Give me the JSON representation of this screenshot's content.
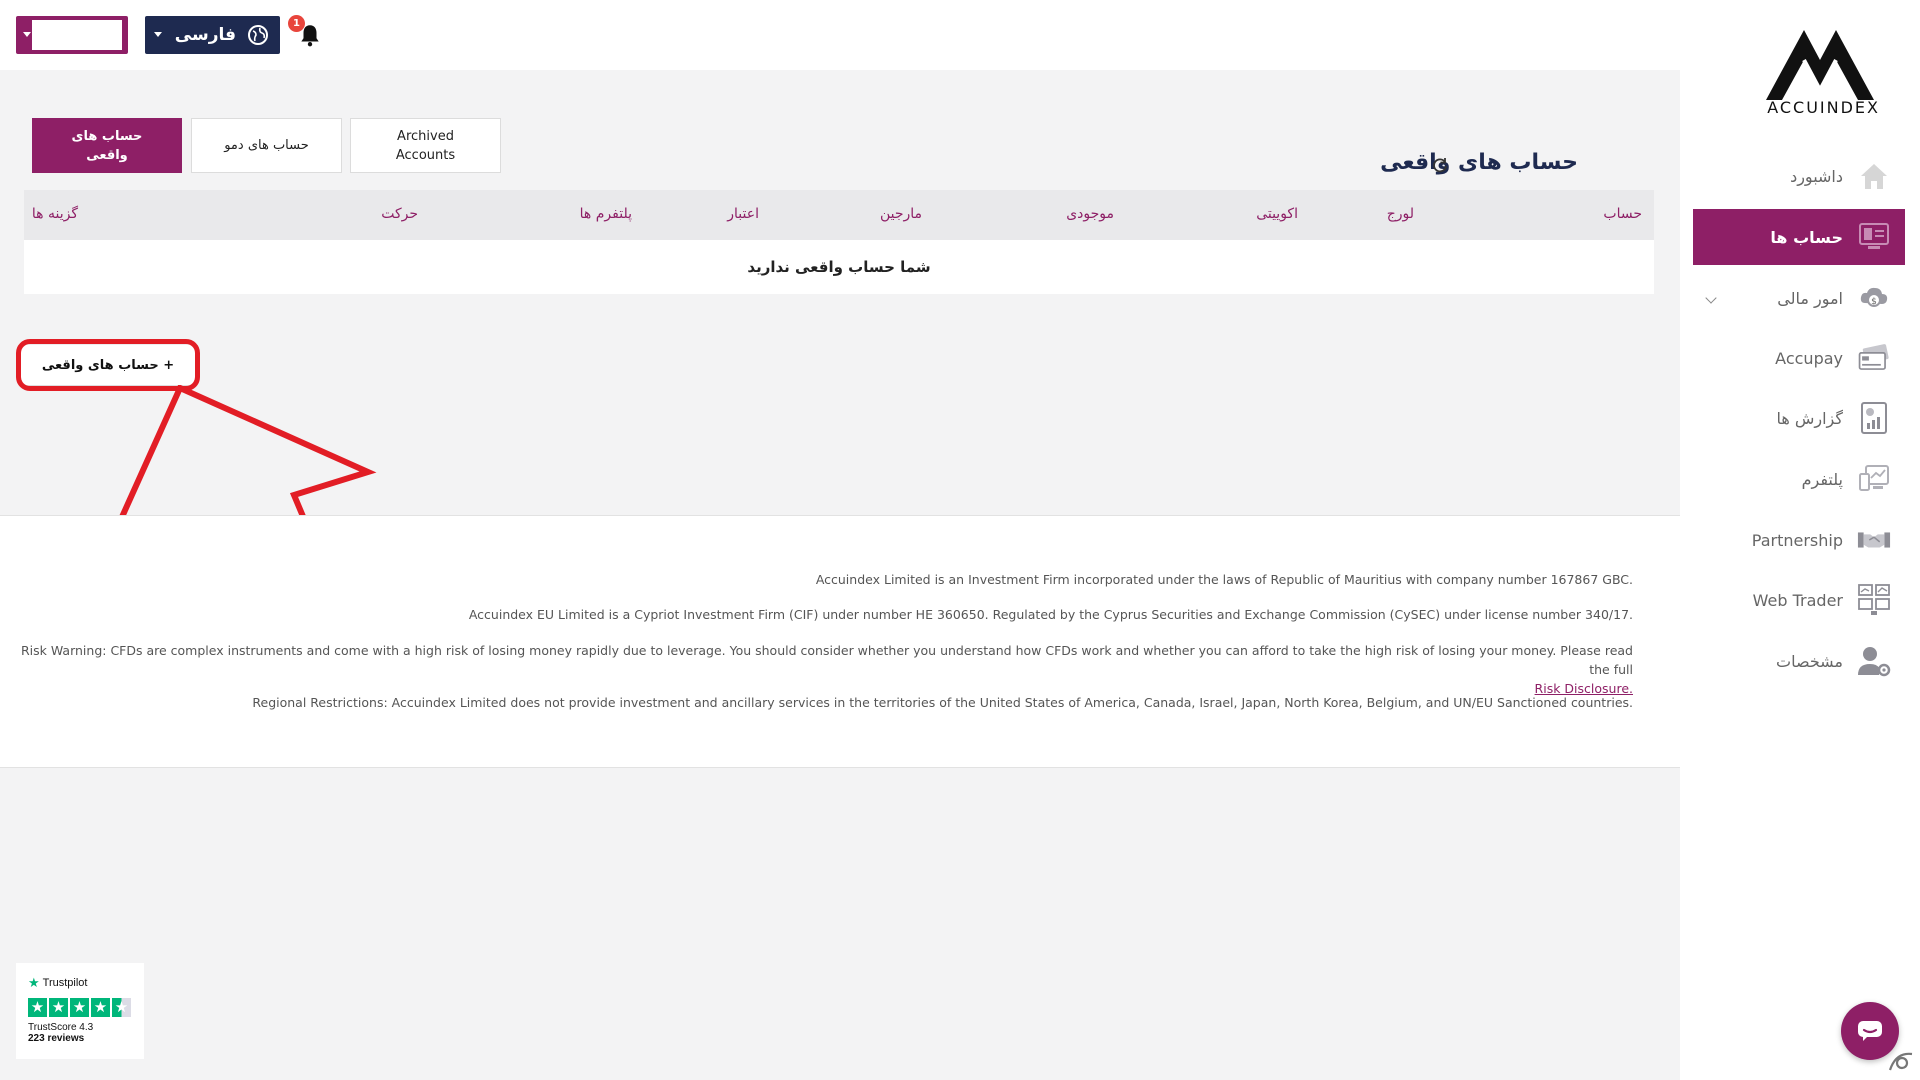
{
  "header": {
    "language_label": "فارسی",
    "notification_count": "1"
  },
  "sidebar": {
    "logo_text": "ACCUINDEX",
    "items": [
      {
        "label": "داشبورد",
        "icon": "home-icon"
      },
      {
        "label": "حساب ها",
        "icon": "accounts-icon",
        "active": true
      },
      {
        "label": "امور مالی",
        "icon": "finance-icon"
      },
      {
        "label": "Accupay",
        "icon": "card-icon"
      },
      {
        "label": "گزارش ها",
        "icon": "report-icon"
      },
      {
        "label": "پلتفرم",
        "icon": "platform-icon"
      },
      {
        "label": "Partnership",
        "icon": "handshake-icon"
      },
      {
        "label": "Web Trader",
        "icon": "web-trader-icon"
      },
      {
        "label": "مشخصات",
        "icon": "profile-icon"
      }
    ]
  },
  "main": {
    "title": "حساب های واقعی",
    "tabs": [
      {
        "label": "حساب های واقعی"
      },
      {
        "label": "حساب های دمو"
      },
      {
        "label": "Archived Accounts"
      }
    ],
    "table": {
      "columns": [
        "حساب",
        "لورج",
        "اکوییتی",
        "موجودی",
        "مارجین",
        "اعتبار",
        "پلتفرم ها",
        "حرکت",
        "گزینه ها"
      ],
      "empty_message": "شما حساب واقعی ندارید"
    },
    "add_button": "+ حساب های واقعی"
  },
  "footer": {
    "line1": "Accuindex Limited is an Investment Firm incorporated under the laws of Republic of Mauritius with company number 167867 GBC.",
    "line2": "Accuindex EU Limited is a Cypriot Investment Firm (CIF) under number HE 360650. Regulated by the Cyprus Securities and Exchange Commission (CySEC) under license number 340/17.",
    "risk_text": "Risk Warning: CFDs are complex instruments and come with a high risk of losing money rapidly due to leverage. You should consider whether you understand how CFDs work and whether you can afford to take the high risk of losing your money. Please read the full",
    "risk_link": "Risk Disclosure.",
    "line4": "Regional Restrictions: Accuindex Limited does not provide investment and ancillary services in the territories of the United States of America, Canada, Israel, Japan, North Korea, Belgium, and UN/EU Sanctioned countries."
  },
  "trustpilot": {
    "brand": "Trustpilot",
    "score": "TrustScore 4.3",
    "reviews": "223 reviews"
  },
  "colors": {
    "accent": "#8e1f66",
    "navy": "#1e2a50",
    "highlight": "#e21d25"
  }
}
